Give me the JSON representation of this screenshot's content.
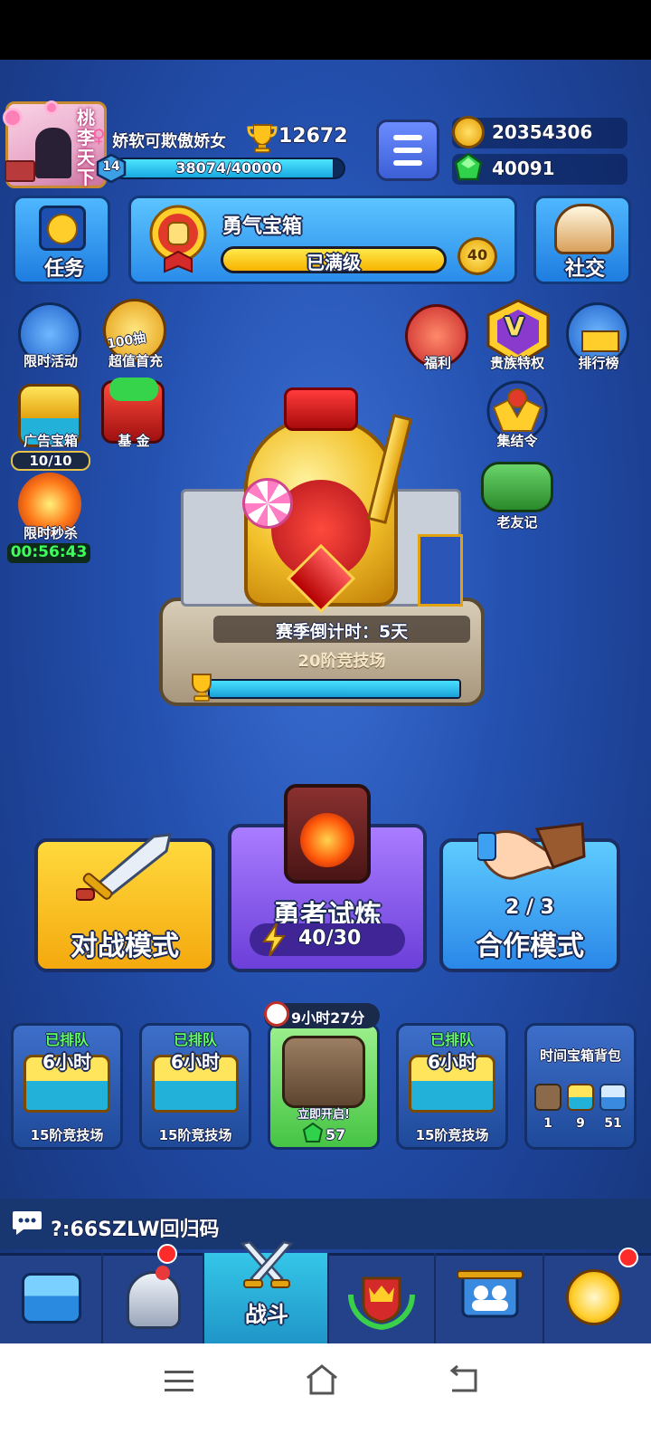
{
  "player": {
    "avatar_title": "桃李天下",
    "name": "娇软可欺傲娇女",
    "gender_symbol": "♀",
    "trophies": "12672",
    "level": "14",
    "xp_text": "38074/40000",
    "xp_fraction": 0.952
  },
  "resources": {
    "gold": "20354306",
    "gems": "40091"
  },
  "top_buttons": {
    "task_label": "任务",
    "social_label": "社交"
  },
  "courage_chest": {
    "title": "勇气宝箱",
    "status": "已满级",
    "badge": "40",
    "progress_fraction": 1.0
  },
  "left_events": [
    {
      "label": "限时活动"
    },
    {
      "label": "超值首充",
      "tag": "100抽"
    },
    {
      "label": "广告宝箱",
      "counter": "10/10"
    },
    {
      "label": "基 金"
    },
    {
      "label": "限时秒杀",
      "timer": "00:56:43"
    }
  ],
  "right_events": [
    {
      "label": "福利"
    },
    {
      "label": "贵族特权",
      "tag": "V"
    },
    {
      "label": "排行榜"
    },
    {
      "label": "集结令"
    },
    {
      "label": "老友记"
    }
  ],
  "arena": {
    "season_countdown": "赛季倒计时：5天",
    "arena_name": "20阶竞技场",
    "progress_fraction": 1.0
  },
  "modes": {
    "battle_label": "对战模式",
    "trial_label": "勇者试炼",
    "trial_energy": "40/30",
    "coop_count": "2 / 3",
    "coop_label": "合作模式"
  },
  "chest_slots": [
    {
      "status": "已排队",
      "time": "6小时",
      "arena": "15阶竞技场"
    },
    {
      "status": "已排队",
      "time": "6小时",
      "arena": "15阶竞技场"
    },
    {
      "timer": "9小时27分",
      "action": "立即开启!",
      "gem_cost": "57"
    },
    {
      "status": "已排队",
      "time": "6小时",
      "arena": "15阶竞技场"
    }
  ],
  "chest_bag": {
    "title": "时间宝箱背包",
    "counts": [
      "1",
      "9",
      "51"
    ]
  },
  "chat": {
    "text": "?:66SZLW回归码"
  },
  "nav": {
    "active_label": "战斗"
  },
  "colors": {
    "background": "#1e3f8c",
    "accent_yellow": "#ffd93d",
    "accent_purple": "#8a5cf0",
    "accent_blue": "#3da8f0",
    "timer_green": "#3dff5a"
  }
}
